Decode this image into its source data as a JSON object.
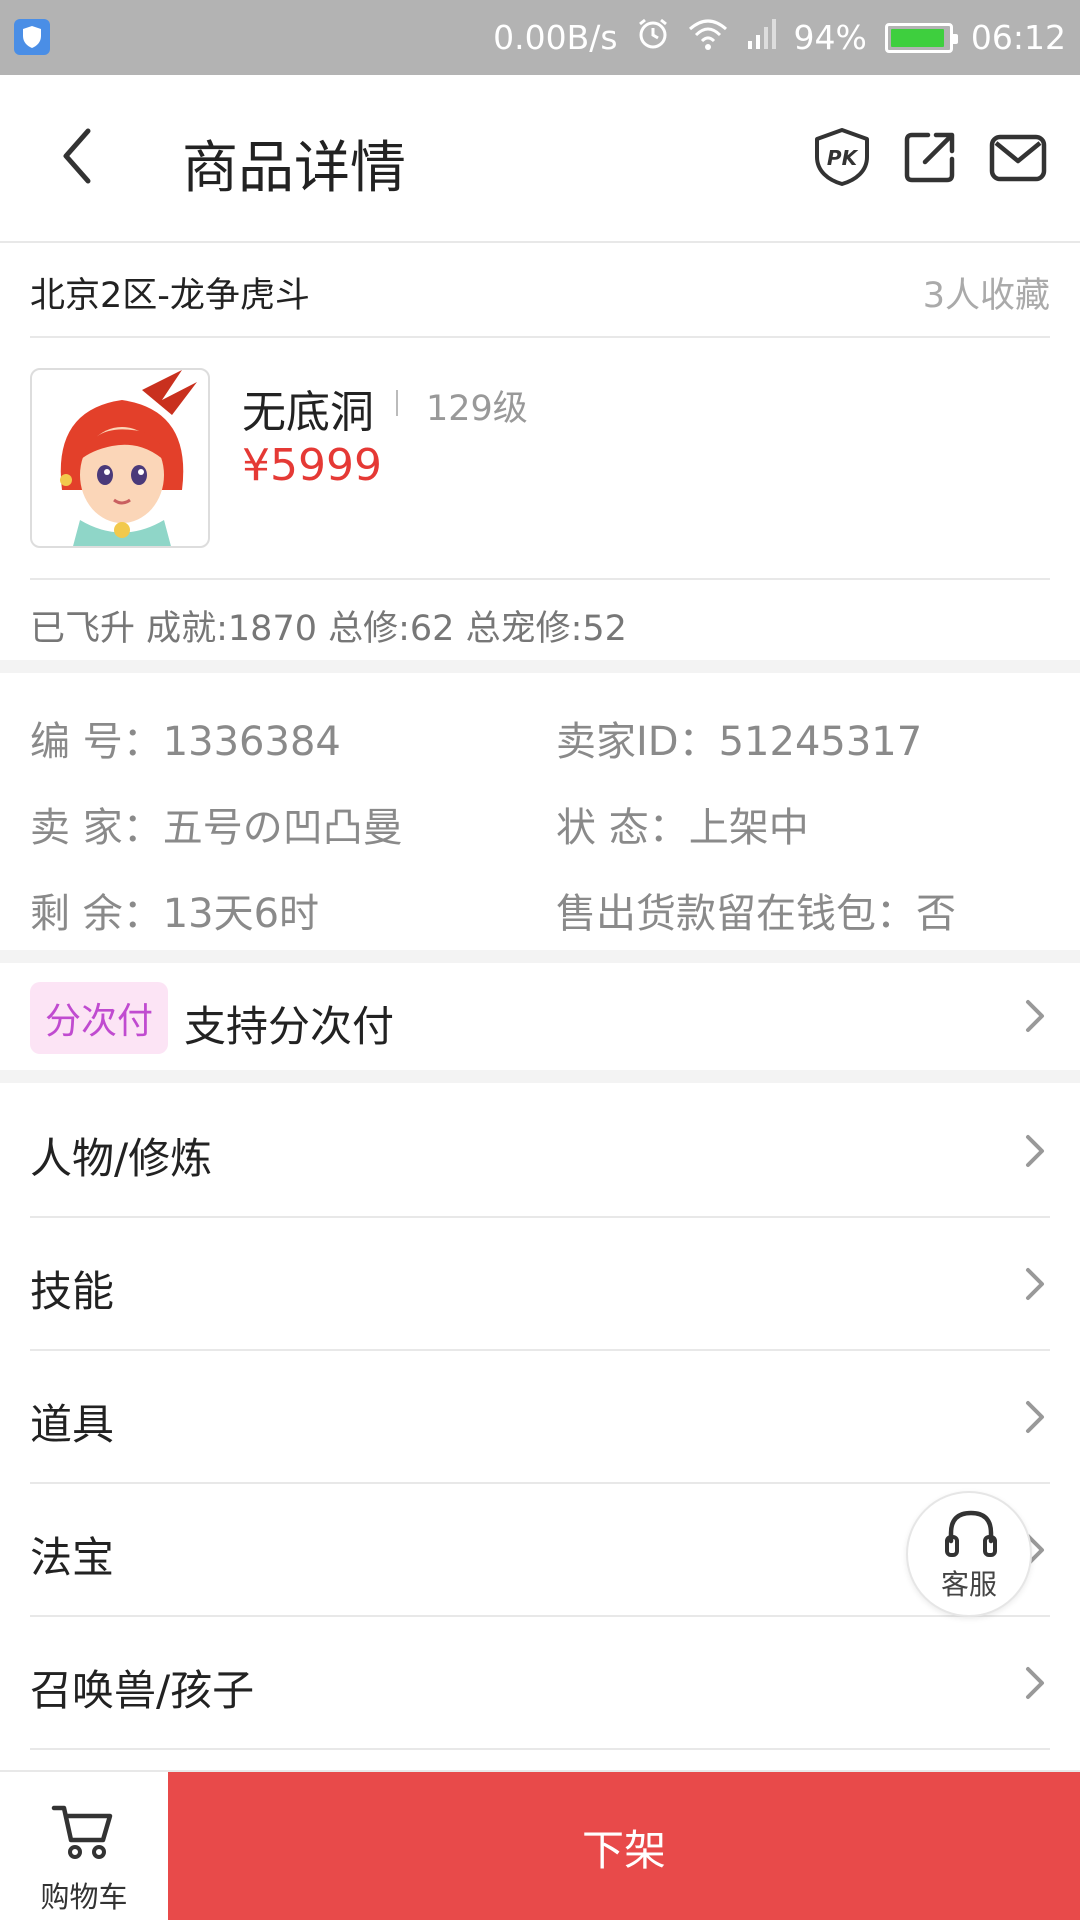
{
  "status_bar": {
    "net_speed": "0.00B/s",
    "battery_pct": "94%",
    "battery_level": 0.94,
    "time": "06:12",
    "icons": [
      "shield-app-icon",
      "alarm-icon",
      "wifi-icon",
      "signal-icon",
      "battery-icon"
    ]
  },
  "header": {
    "title": "商品详情",
    "icons": [
      "back-icon",
      "pk-icon",
      "share-icon",
      "mail-icon"
    ]
  },
  "server": {
    "name": "北京2区-龙争虎斗",
    "favorites": "3人收藏"
  },
  "character": {
    "name": "无底洞",
    "level": "129级",
    "price": "¥5999",
    "stats": "已飞升 成就:1870 总修:62 总宠修:52"
  },
  "info": {
    "id_text": "编  号：1336384",
    "seller_id_text": "卖家ID：51245317",
    "seller_text": "卖  家：五号の凹凸曼",
    "status_text": "状  态：上架中",
    "remaining_text": "剩  余：13天6时",
    "wallet_text": "售出货款留在钱包：否"
  },
  "installment": {
    "badge": "分次付",
    "label": "支持分次付"
  },
  "menu": [
    {
      "label": "人物/修炼"
    },
    {
      "label": "技能"
    },
    {
      "label": "道具"
    },
    {
      "label": "法宝"
    },
    {
      "label": "召唤兽/孩子"
    }
  ],
  "customer_service": {
    "label": "客服"
  },
  "bottom": {
    "cart_label": "购物车",
    "action_label": "下架"
  },
  "colors": {
    "accent_red": "#e84a4a",
    "price_red": "#e53935",
    "badge_bg": "#fce4f5",
    "badge_text": "#c04bd0",
    "status_bar": "#b3b3b3"
  }
}
